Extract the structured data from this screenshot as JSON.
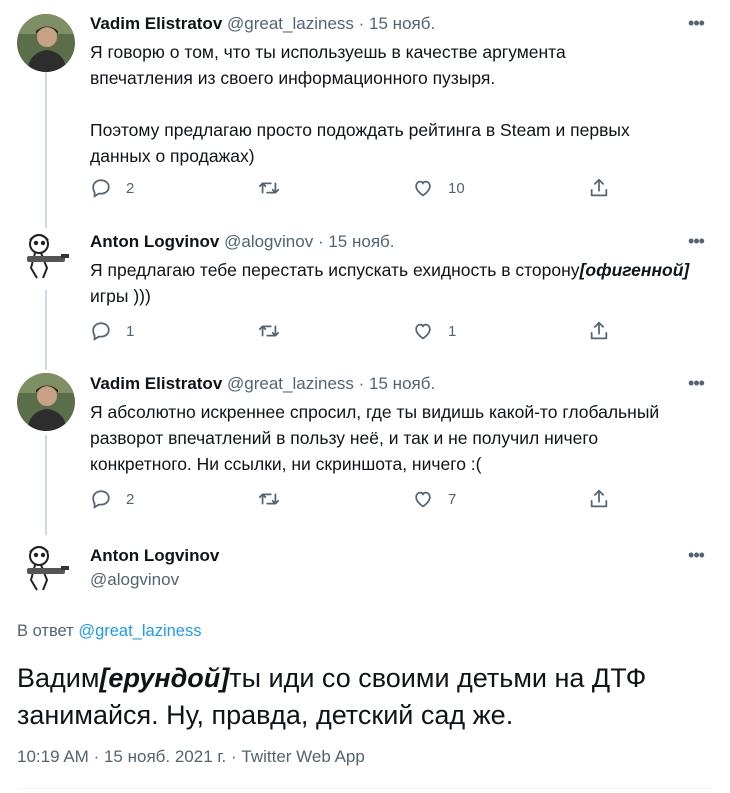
{
  "tweets": [
    {
      "name": "Vadim Elistratov",
      "handle": "@great_laziness",
      "sep": "·",
      "date": "15 нояб.",
      "text": "Я говорю о том, что ты используешь в качестве аргумента\nвпечатления из своего информационного пузыря.\n\nПоэтому предлагаю просто подождать рейтинга в Steam и первых\nданных о продажах)",
      "replies": "2",
      "retweets": "",
      "likes": "10"
    },
    {
      "name": "Anton Logvinov",
      "handle": "@alogvinov",
      "sep": "·",
      "date": "15 нояб.",
      "text_before": "Я предлагаю тебе перестать испускать ехидность в сторону",
      "text_insert": "[офигенной]",
      "text_after": "\nигры )))",
      "replies": "1",
      "retweets": "",
      "likes": "1"
    },
    {
      "name": "Vadim Elistratov",
      "handle": "@great_laziness",
      "sep": "·",
      "date": "15 нояб.",
      "text": "Я абсолютно искреннее спросил, где ты видишь какой-то глобальный\nразворот впечатлений в пользу неё, и так и не получил ничего\nконкретного. Ни ссылки, ни скриншота, ничего :(",
      "replies": "2",
      "retweets": "",
      "likes": "7"
    }
  ],
  "main_tweet": {
    "name": "Anton Logvinov",
    "handle": "@alogvinov",
    "reply_label": "В ответ",
    "reply_to": "@great_laziness",
    "text_before": "Вадим",
    "text_insert": "[ерундой]",
    "text_after": "ты иди со своими детьми на ДТФ\nзанимайся. Ну, правда, детский сад же.",
    "time": "10:19 AM",
    "date": "15 нояб. 2021 г.",
    "source": "Twitter Web App",
    "sep": "·"
  },
  "icons": {
    "more": "more-dots-icon",
    "reply": "reply-bubble-icon",
    "retweet": "retweet-icon",
    "like": "heart-icon",
    "share": "share-icon"
  },
  "colors": {
    "text": "#0f1419",
    "muted": "#536471",
    "link": "#1d9bf0",
    "thread_line": "#cfd9de"
  }
}
